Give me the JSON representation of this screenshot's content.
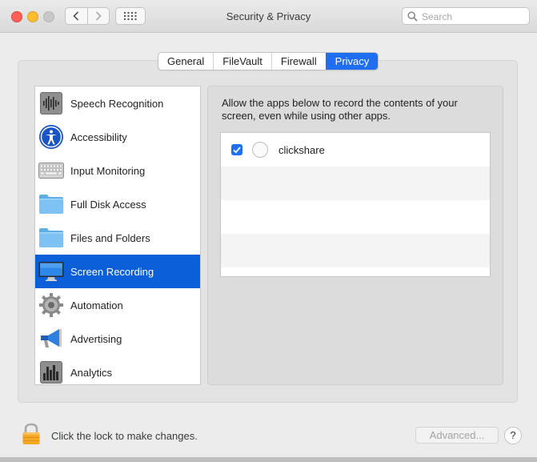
{
  "window": {
    "title": "Security & Privacy"
  },
  "search": {
    "placeholder": "Search"
  },
  "tabs": [
    {
      "label": "General",
      "active": false
    },
    {
      "label": "FileVault",
      "active": false
    },
    {
      "label": "Firewall",
      "active": false
    },
    {
      "label": "Privacy",
      "active": true
    }
  ],
  "categories": [
    {
      "label": "Speech Recognition",
      "icon": "speech-recognition-icon"
    },
    {
      "label": "Accessibility",
      "icon": "accessibility-icon"
    },
    {
      "label": "Input Monitoring",
      "icon": "keyboard-icon"
    },
    {
      "label": "Full Disk Access",
      "icon": "folder-icon"
    },
    {
      "label": "Files and Folders",
      "icon": "folder-icon"
    },
    {
      "label": "Screen Recording",
      "icon": "display-icon",
      "selected": true
    },
    {
      "label": "Automation",
      "icon": "gear-icon"
    },
    {
      "label": "Advertising",
      "icon": "megaphone-icon"
    },
    {
      "label": "Analytics",
      "icon": "analytics-icon"
    }
  ],
  "privacy": {
    "description": "Allow the apps below to record the contents of your screen, even while using other apps.",
    "apps": [
      {
        "name": "clickshare",
        "checked": true
      }
    ]
  },
  "footer": {
    "lock_text": "Click the lock to make changes.",
    "advanced_label": "Advanced...",
    "help_label": "?"
  },
  "colors": {
    "accent": "#1f6ef1",
    "selection": "#0b5fd9"
  }
}
